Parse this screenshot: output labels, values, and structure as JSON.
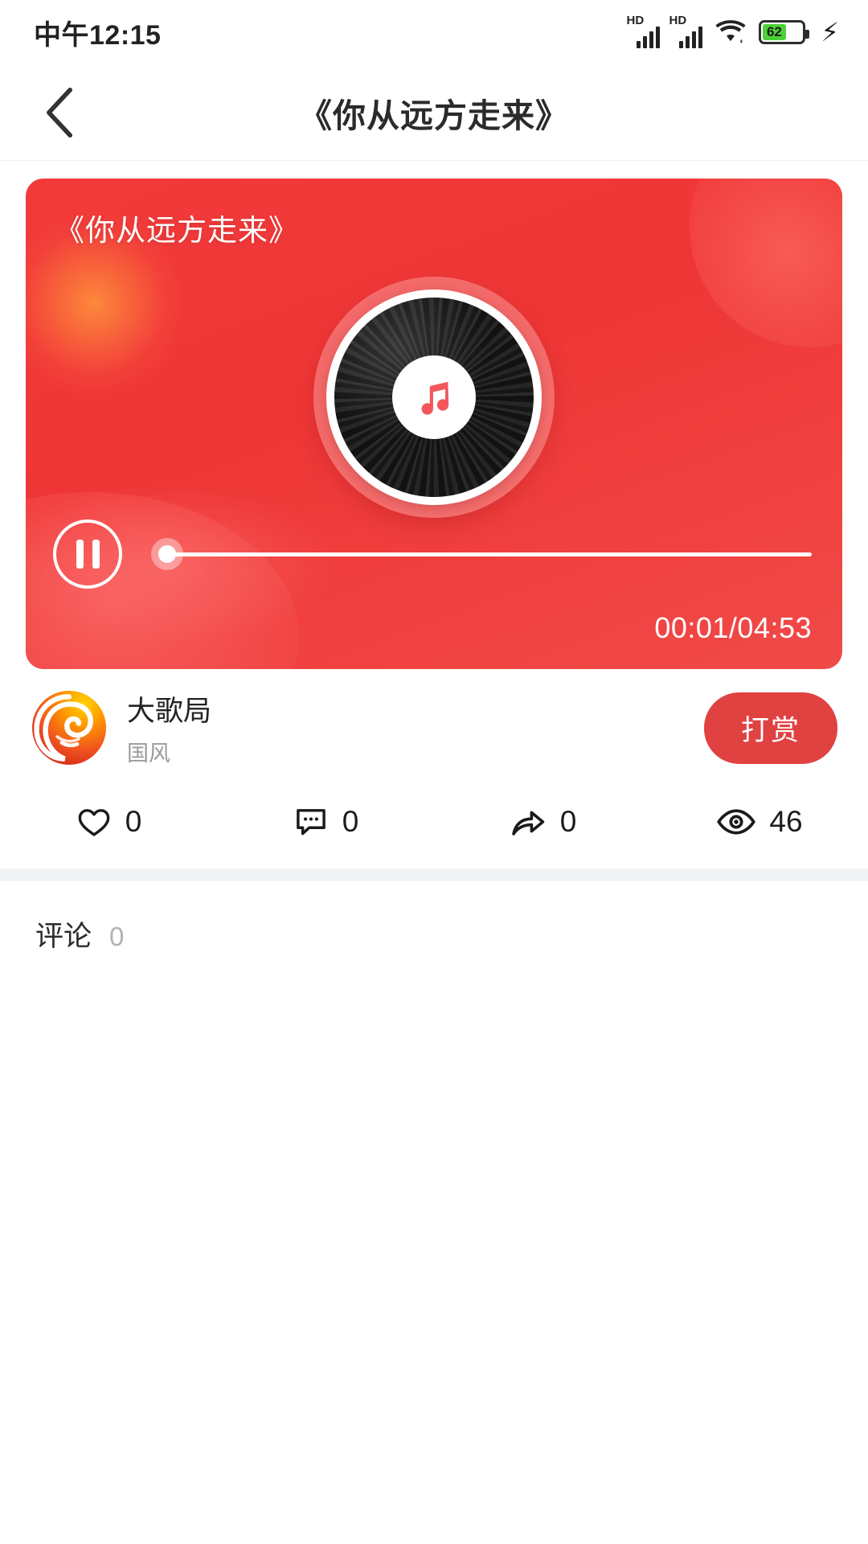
{
  "status_bar": {
    "time": "中午12:15",
    "hd_label": "HD",
    "battery_percent": "62",
    "battery_level": 62,
    "charging": true,
    "icons": [
      "hd-signal-icon",
      "hd-signal-icon",
      "wifi-icon",
      "battery-icon",
      "charging-bolt-icon"
    ]
  },
  "header": {
    "back_label": "",
    "title": "《你从远方走来》"
  },
  "player": {
    "card_title": "《你从远方走来》",
    "state": "playing",
    "pause_label": "",
    "progress_percent": 0.3,
    "current_time": "00:01",
    "total_time": "04:53",
    "time_display": "00:01/04:53",
    "accent_color": "#ef3636",
    "note_color": "#f2575c"
  },
  "author": {
    "name": "大歌局",
    "subtitle": "国风",
    "reward_label": "打赏",
    "reward_color": "#e04141"
  },
  "stats": [
    {
      "icon": "heart-icon",
      "name": "like",
      "value": "0"
    },
    {
      "icon": "comment-icon",
      "name": "comment",
      "value": "0"
    },
    {
      "icon": "share-icon",
      "name": "share",
      "value": "0"
    },
    {
      "icon": "eye-icon",
      "name": "views",
      "value": "46"
    }
  ],
  "comments": {
    "label": "评论",
    "count": "0"
  }
}
